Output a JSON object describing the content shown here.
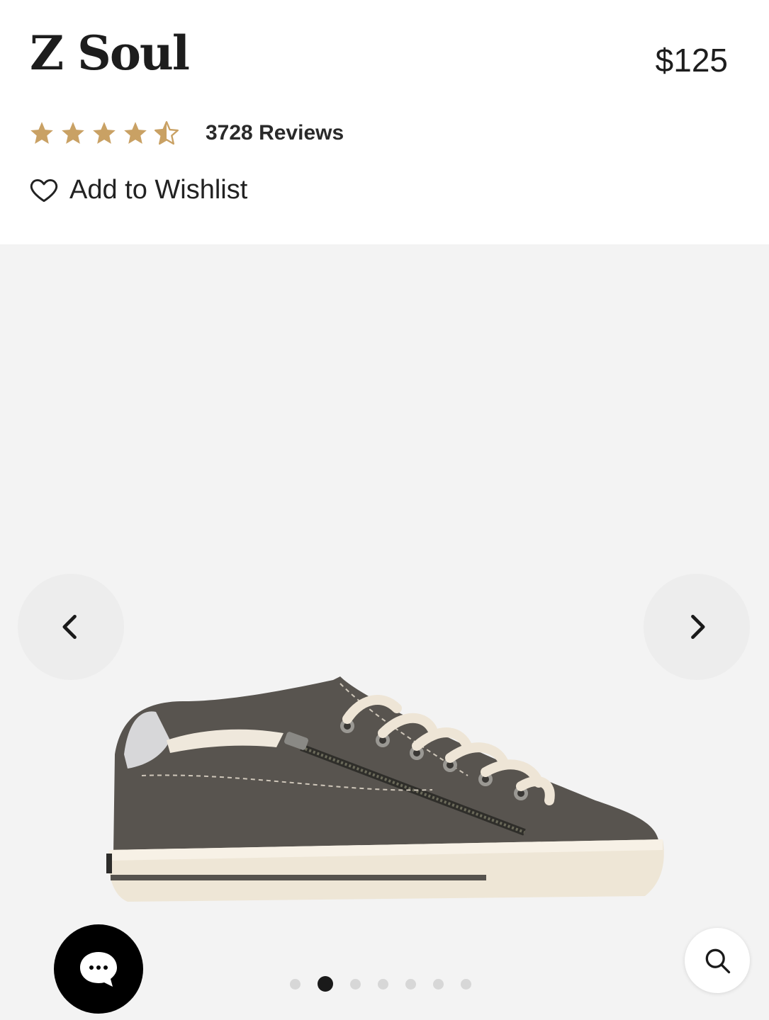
{
  "product": {
    "title": "Z Soul",
    "price": "$125",
    "rating": 4.5,
    "rating_max": 5,
    "reviews_label": "3728 Reviews",
    "wishlist_label": "Add to Wishlist"
  },
  "gallery": {
    "slide_count": 7,
    "active_slide": 2,
    "prev_icon": "chevron-left-icon",
    "next_icon": "chevron-right-icon"
  },
  "widgets": {
    "chat_icon": "chat-bubble-icon",
    "search_icon": "search-icon"
  },
  "colors": {
    "star": "#c9a164",
    "gallery_bg": "#f3f3f3",
    "nav_bg": "#ededed",
    "dot_active": "#1a1a1a",
    "dot_inactive": "#d7d7d7"
  }
}
